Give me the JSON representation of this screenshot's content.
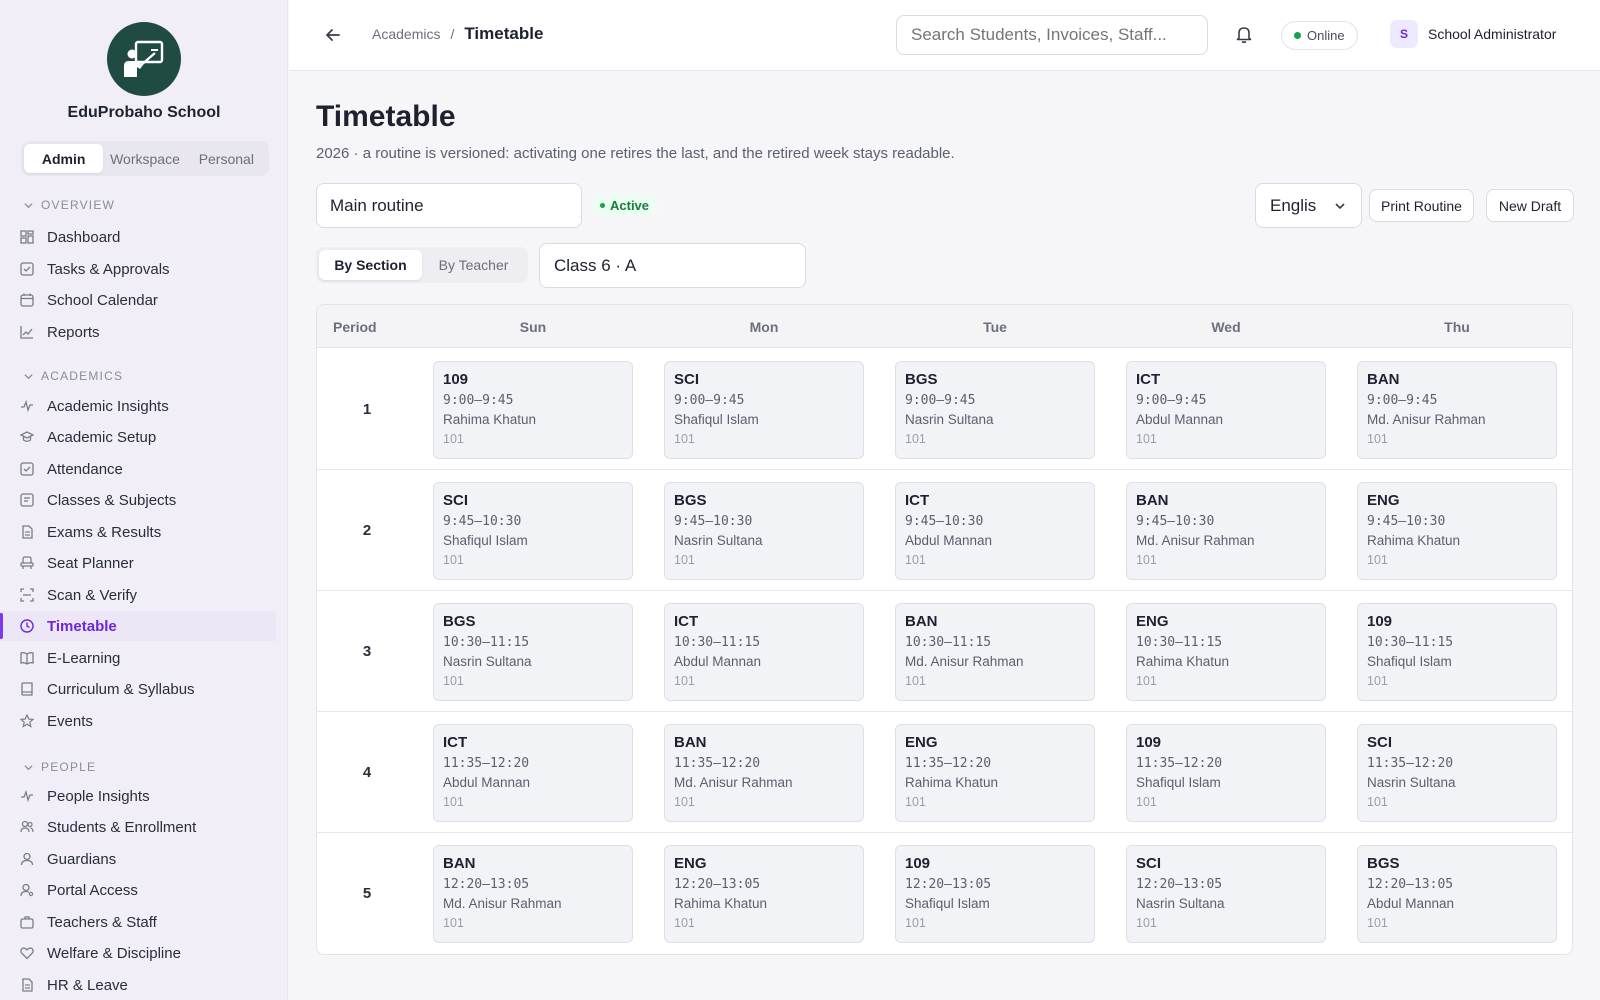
{
  "sidebar": {
    "school_name": "EduProbaho School",
    "roles": [
      "Admin",
      "Workspace",
      "Personal"
    ],
    "active_role": "Admin",
    "sections": [
      {
        "label": "OVERVIEW",
        "items": [
          "Dashboard",
          "Tasks & Approvals",
          "School Calendar",
          "Reports"
        ]
      },
      {
        "label": "ACADEMICS",
        "items": [
          "Academic Insights",
          "Academic Setup",
          "Attendance",
          "Classes & Subjects",
          "Exams & Results",
          "Seat Planner",
          "Scan & Verify",
          "Timetable",
          "E-Learning",
          "Curriculum & Syllabus",
          "Events"
        ]
      },
      {
        "label": "PEOPLE",
        "items": [
          "People Insights",
          "Students & Enrollment",
          "Guardians",
          "Portal Access",
          "Teachers & Staff",
          "Welfare & Discipline",
          "HR & Leave"
        ]
      }
    ],
    "active_item": "Timetable"
  },
  "header": {
    "breadcrumb_parent": "Academics",
    "breadcrumb_sep": "/",
    "breadcrumb_current": "Timetable",
    "search_placeholder": "Search Students, Invoices, Staff...",
    "status": "Online",
    "status_color": "#16a34a",
    "user_initial": "S",
    "user_name": "School Administrator"
  },
  "page": {
    "title": "Timetable",
    "subtitle": "2026 · a routine is versioned: activating one retires the last, and the retired week stays readable.",
    "routine": "Main routine",
    "routine_status": "Active",
    "language": "Englis",
    "print_label": "Print Routine",
    "new_draft_label": "New Draft",
    "views": [
      "By Section",
      "By Teacher"
    ],
    "active_view": "By Section",
    "class_selected": "Class 6 · A"
  },
  "timetable": {
    "period_header": "Period",
    "days": [
      "Sun",
      "Mon",
      "Tue",
      "Wed",
      "Thu"
    ],
    "rows": [
      {
        "period": "1",
        "cells": [
          {
            "subject": "109",
            "time": "9:00–9:45",
            "teacher": "Rahima Khatun",
            "room": "101"
          },
          {
            "subject": "SCI",
            "time": "9:00–9:45",
            "teacher": "Shafiqul Islam",
            "room": "101"
          },
          {
            "subject": "BGS",
            "time": "9:00–9:45",
            "teacher": "Nasrin Sultana",
            "room": "101"
          },
          {
            "subject": "ICT",
            "time": "9:00–9:45",
            "teacher": "Abdul Mannan",
            "room": "101"
          },
          {
            "subject": "BAN",
            "time": "9:00–9:45",
            "teacher": "Md. Anisur Rahman",
            "room": "101"
          }
        ]
      },
      {
        "period": "2",
        "cells": [
          {
            "subject": "SCI",
            "time": "9:45–10:30",
            "teacher": "Shafiqul Islam",
            "room": "101"
          },
          {
            "subject": "BGS",
            "time": "9:45–10:30",
            "teacher": "Nasrin Sultana",
            "room": "101"
          },
          {
            "subject": "ICT",
            "time": "9:45–10:30",
            "teacher": "Abdul Mannan",
            "room": "101"
          },
          {
            "subject": "BAN",
            "time": "9:45–10:30",
            "teacher": "Md. Anisur Rahman",
            "room": "101"
          },
          {
            "subject": "ENG",
            "time": "9:45–10:30",
            "teacher": "Rahima Khatun",
            "room": "101"
          }
        ]
      },
      {
        "period": "3",
        "cells": [
          {
            "subject": "BGS",
            "time": "10:30–11:15",
            "teacher": "Nasrin Sultana",
            "room": "101"
          },
          {
            "subject": "ICT",
            "time": "10:30–11:15",
            "teacher": "Abdul Mannan",
            "room": "101"
          },
          {
            "subject": "BAN",
            "time": "10:30–11:15",
            "teacher": "Md. Anisur Rahman",
            "room": "101"
          },
          {
            "subject": "ENG",
            "time": "10:30–11:15",
            "teacher": "Rahima Khatun",
            "room": "101"
          },
          {
            "subject": "109",
            "time": "10:30–11:15",
            "teacher": "Shafiqul Islam",
            "room": "101"
          }
        ]
      },
      {
        "period": "4",
        "cells": [
          {
            "subject": "ICT",
            "time": "11:35–12:20",
            "teacher": "Abdul Mannan",
            "room": "101"
          },
          {
            "subject": "BAN",
            "time": "11:35–12:20",
            "teacher": "Md. Anisur Rahman",
            "room": "101"
          },
          {
            "subject": "ENG",
            "time": "11:35–12:20",
            "teacher": "Rahima Khatun",
            "room": "101"
          },
          {
            "subject": "109",
            "time": "11:35–12:20",
            "teacher": "Shafiqul Islam",
            "room": "101"
          },
          {
            "subject": "SCI",
            "time": "11:35–12:20",
            "teacher": "Nasrin Sultana",
            "room": "101"
          }
        ]
      },
      {
        "period": "5",
        "cells": [
          {
            "subject": "BAN",
            "time": "12:20–13:05",
            "teacher": "Md. Anisur Rahman",
            "room": "101"
          },
          {
            "subject": "ENG",
            "time": "12:20–13:05",
            "teacher": "Rahima Khatun",
            "room": "101"
          },
          {
            "subject": "109",
            "time": "12:20–13:05",
            "teacher": "Shafiqul Islam",
            "room": "101"
          },
          {
            "subject": "SCI",
            "time": "12:20–13:05",
            "teacher": "Nasrin Sultana",
            "room": "101"
          },
          {
            "subject": "BGS",
            "time": "12:20–13:05",
            "teacher": "Abdul Mannan",
            "room": "101"
          }
        ]
      }
    ]
  },
  "colors": {
    "accent": "#7c3aed",
    "brand": "#1f4b43",
    "active_badge": "#15803d"
  }
}
